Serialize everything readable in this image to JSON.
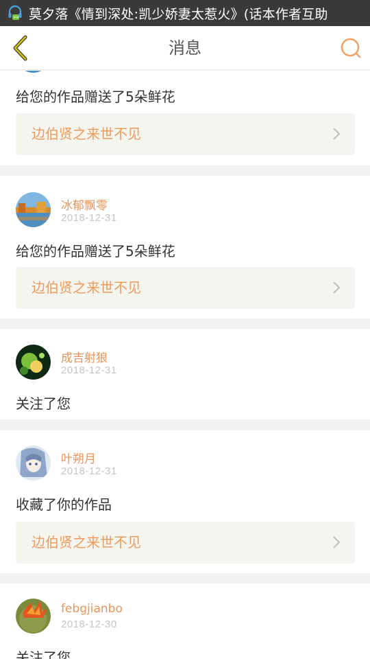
{
  "status_bar": {
    "notification_text": "莫夕落《情到深处:凯少娇妻太惹火》(话本作者互助"
  },
  "header": {
    "title": "消息"
  },
  "messages": [
    {
      "action": "给您的作品赠送了5朵鲜花",
      "work_title": "边伯贤之来世不见"
    },
    {
      "username": "冰郁飘零",
      "date": "2018-12-31",
      "action": "给您的作品赠送了5朵鲜花",
      "work_title": "边伯贤之来世不见"
    },
    {
      "username": "成吉射狼",
      "date": "2018-12-31",
      "action": "关注了您"
    },
    {
      "username": "叶朔月",
      "date": "2018-12-31",
      "action": "收藏了你的作品",
      "work_title": "边伯贤之来世不见"
    },
    {
      "username": "febgjianbo",
      "date": "2018-12-30",
      "action": "关注了您"
    }
  ],
  "colors": {
    "accent": "#e8935a",
    "back_icon": "#d4c300",
    "status_bar": "#3a3a3a",
    "link_bg": "#f5f5ef"
  },
  "icons": {
    "back": "chevron-left-icon",
    "search": "search-icon",
    "chevron": "chevron-right-icon"
  }
}
